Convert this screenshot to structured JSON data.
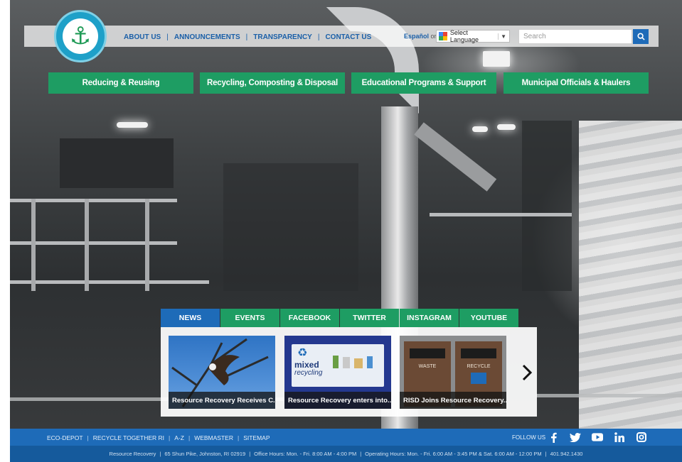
{
  "header": {
    "nav": [
      "ABOUT US",
      "ANNOUNCEMENTS",
      "TRANSPARENCY",
      "CONTACT US"
    ],
    "espanol": "Español",
    "or": "or",
    "translate_label": "Select Language",
    "translate_caret": "▼",
    "search_placeholder": "Search"
  },
  "categories": [
    "Reducing & Reusing",
    "Recycling, Composting & Disposal",
    "Educational Programs & Support",
    "Municipal Officials & Haulers"
  ],
  "tabs": [
    "NEWS",
    "EVENTS",
    "FACEBOOK",
    "TWITTER",
    "INSTAGRAM",
    "YOUTUBE"
  ],
  "active_tab": "NEWS",
  "news": [
    {
      "caption": "Resource Recovery Receives C..."
    },
    {
      "caption": "Resource Recovery enters into...",
      "sign_title": "mixed",
      "sign_sub": "recycling"
    },
    {
      "caption": "RISD Joins Resource Recovery...",
      "bin_left": "WASTE",
      "bin_right": "RECYCLE"
    }
  ],
  "footer": {
    "links": [
      "ECO-DEPOT",
      "RECYCLE TOGETHER RI",
      "A-Z",
      "WEBMASTER",
      "SITEMAP"
    ],
    "follow_label": "FOLLOW US",
    "address_parts": [
      "Resource Recovery",
      "65 Shun Pike, Johnston, RI 02919",
      "Office Hours:  Mon. - Fri. 8:00 AM - 4:00 PM",
      "Operating Hours:  Mon. - Fri. 6:00 AM - 3:45 PM & Sat. 6:00 AM - 12:00 PM",
      "401.942.1430"
    ]
  },
  "colors": {
    "green": "#1e9d63",
    "blue": "#1e6bb8",
    "dark_blue": "#155a9c",
    "nav_text": "#1a5fa8"
  }
}
